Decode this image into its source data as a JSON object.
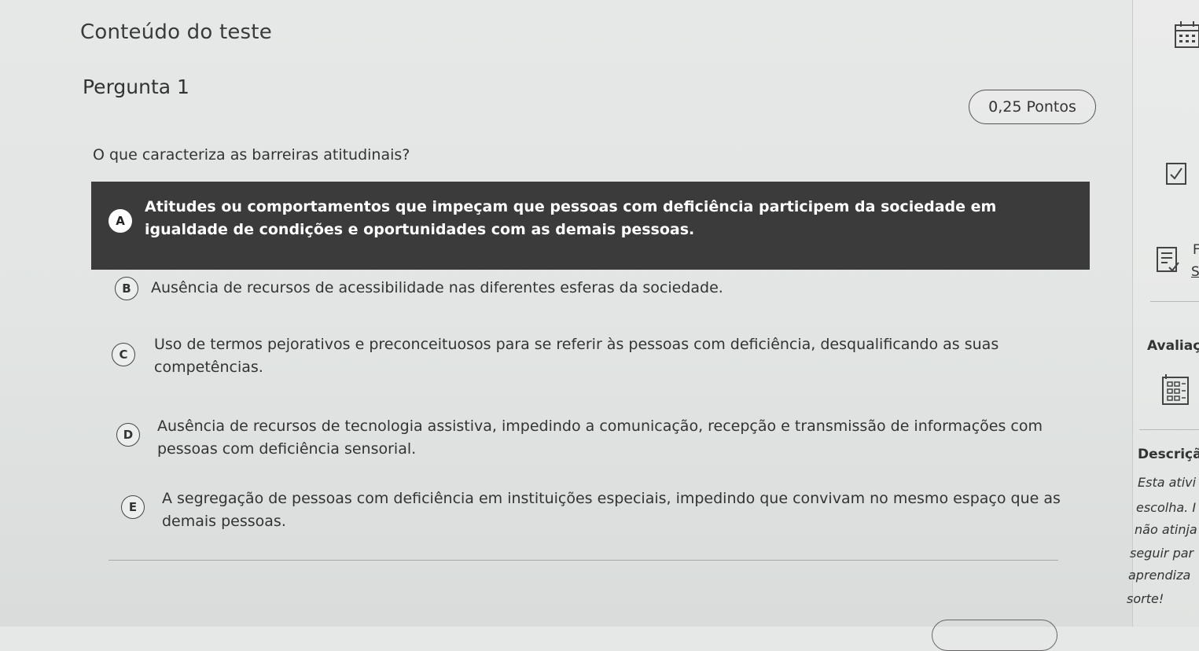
{
  "header": {
    "section_title": "Conteúdo do teste"
  },
  "question": {
    "title": "Pergunta 1",
    "points": "0,25 Pontos",
    "text": "O que caracteriza as barreiras atitudinais?",
    "options": [
      {
        "letter": "A",
        "text": "Atitudes ou comportamentos que impeçam que pessoas com deficiência participem da sociedade em igualdade de condições e oportunidades com as demais pessoas.",
        "selected": true
      },
      {
        "letter": "B",
        "text": "Ausência de recursos de acessibilidade nas diferentes esferas da sociedade.",
        "selected": false
      },
      {
        "letter": "C",
        "text": "Uso de termos pejorativos e preconceituosos para se referir às pessoas com deficiência, desqualificando as suas competências.",
        "selected": false
      },
      {
        "letter": "D",
        "text": "Ausência de recursos de tecnologia assistiva, impedindo a comunicação, recepção e transmissão de informações com pessoas com deficiência sensorial.",
        "selected": false
      },
      {
        "letter": "E",
        "text": "A segregação de pessoas com deficiência em instituições especiais, impedindo que convivam no mesmo espaço que as demais pessoas.",
        "selected": false
      }
    ]
  },
  "right_panel": {
    "top_icon": "calendar-grid-icon",
    "check_icon": "checkbox-checked-icon",
    "doc_icon": "document-check-icon",
    "doc_side_text_1": "F",
    "doc_side_text_2": "S",
    "avaliacao_label": "Avaliaç",
    "grid_icon": "rubric-grid-icon",
    "descricao_label": "Descriçã",
    "descricao_lines": [
      "Esta ativi",
      "escolha. I",
      "não atinja",
      "seguir par",
      "aprendiza",
      "sorte!"
    ]
  },
  "colors": {
    "selected_bg": "#3b3b3b",
    "page_bg": "#e4e6e5"
  }
}
